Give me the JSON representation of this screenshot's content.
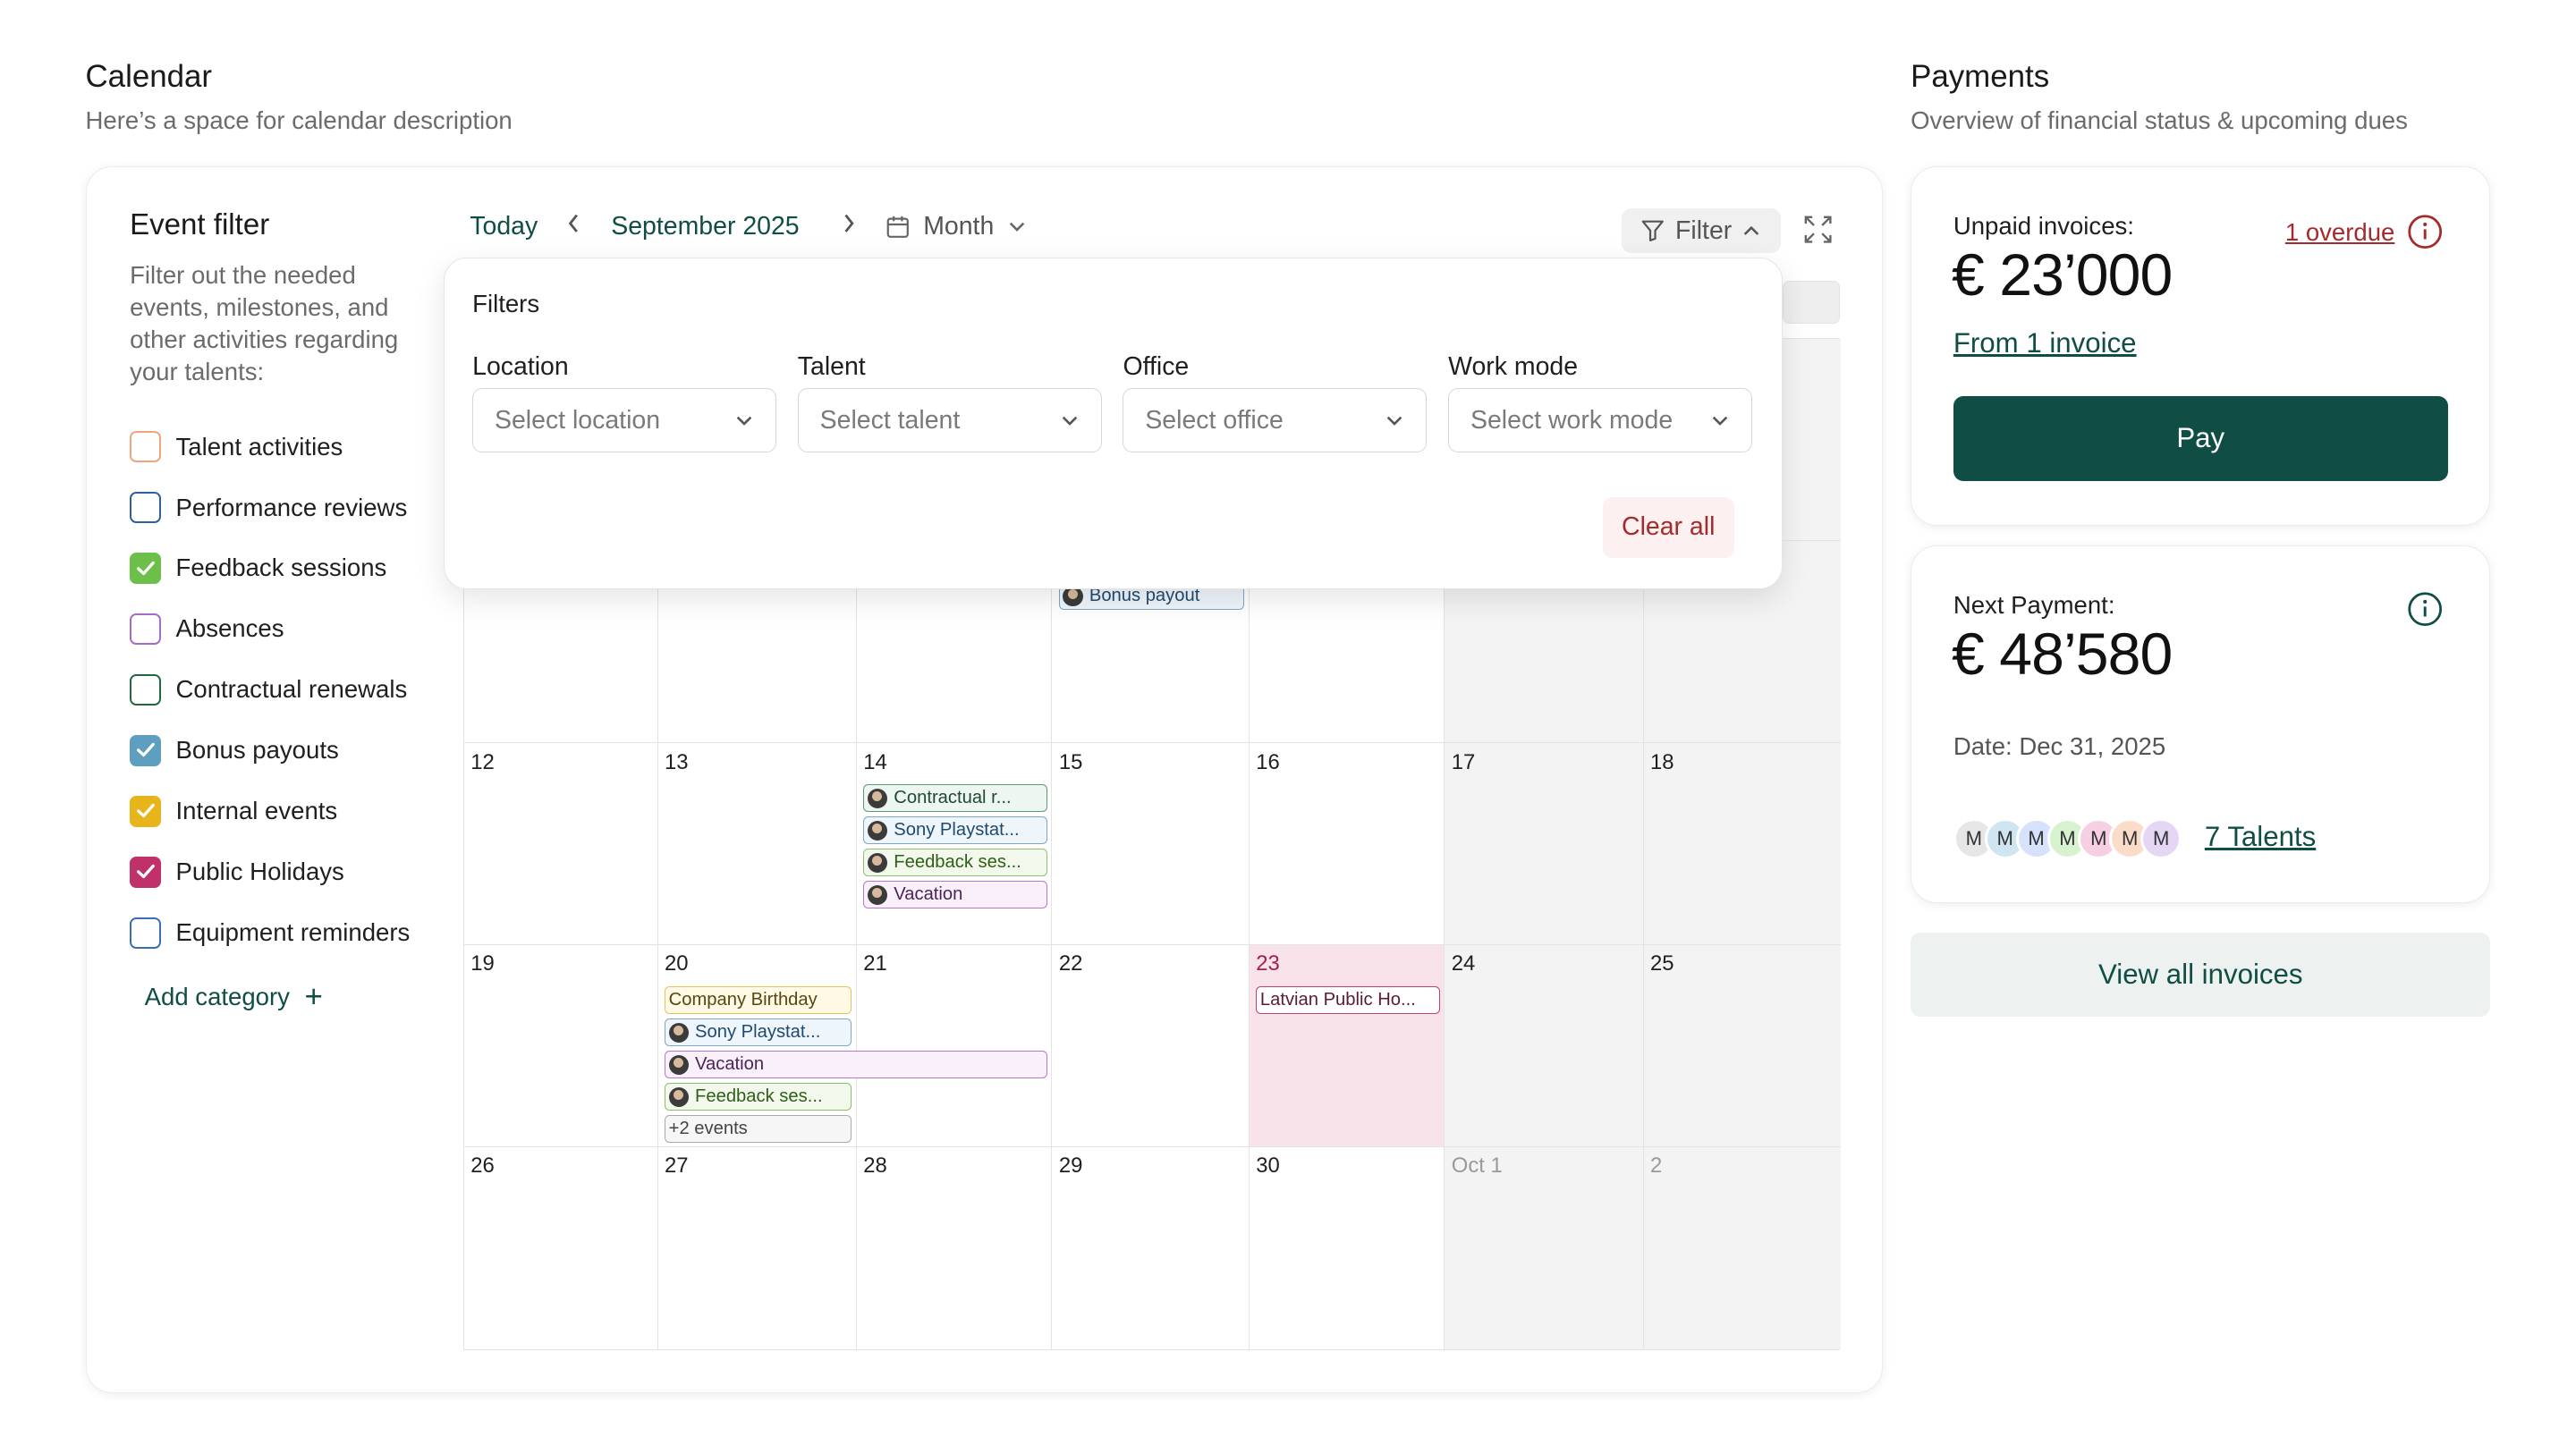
{
  "calendar": {
    "title": "Calendar",
    "description": "Here’s a space for calendar description"
  },
  "event_filter": {
    "title": "Event filter",
    "description": "Filter out the needed events, milestones, and other activities regarding your talents:",
    "categories": [
      {
        "label": "Talent activities",
        "checked": false,
        "color": "#f0a57a"
      },
      {
        "label": "Performance reviews",
        "checked": false,
        "color": "#2f5f9e"
      },
      {
        "label": "Feedback sessions",
        "checked": true,
        "color": "#6cc04a"
      },
      {
        "label": "Absences",
        "checked": false,
        "color": "#a66bc9"
      },
      {
        "label": "Contractual renewals",
        "checked": false,
        "color": "#1f6a45"
      },
      {
        "label": "Bonus payouts",
        "checked": true,
        "color": "#5e9fbf"
      },
      {
        "label": "Internal events",
        "checked": true,
        "color": "#e8b41c"
      },
      {
        "label": "Public Holidays",
        "checked": true,
        "color": "#c0306a"
      },
      {
        "label": "Equipment reminders",
        "checked": false,
        "color": "#3a6fb5"
      }
    ],
    "add_category": "Add category",
    "add_icon": "+"
  },
  "toolbar": {
    "today": "Today",
    "prev": "‹",
    "month_label": "September 2025",
    "next": "›",
    "view": "Month",
    "filter": "Filter"
  },
  "grid_rows": [
    {
      "days": [
        {
          "num": "",
          "weekend": false
        },
        {
          "num": "",
          "weekend": false
        },
        {
          "num": "",
          "weekend": false
        },
        {
          "num": "",
          "weekend": false
        },
        {
          "num": "",
          "weekend": false
        },
        {
          "num": "",
          "weekend": true
        },
        {
          "num": "",
          "weekend": true
        }
      ]
    },
    {
      "days": [
        {
          "num": "",
          "weekend": false
        },
        {
          "num": "",
          "weekend": false
        },
        {
          "num": "",
          "weekend": false
        },
        {
          "num": "",
          "weekend": false
        },
        {
          "num": "",
          "weekend": false
        },
        {
          "num": "",
          "weekend": true
        },
        {
          "num": "",
          "weekend": true
        }
      ]
    },
    {
      "days": [
        {
          "num": "12",
          "weekend": false
        },
        {
          "num": "13",
          "weekend": false
        },
        {
          "num": "14",
          "weekend": false
        },
        {
          "num": "15",
          "weekend": false
        },
        {
          "num": "16",
          "weekend": false
        },
        {
          "num": "17",
          "weekend": true
        },
        {
          "num": "18",
          "weekend": true
        }
      ]
    },
    {
      "days": [
        {
          "num": "19",
          "weekend": false
        },
        {
          "num": "20",
          "weekend": false
        },
        {
          "num": "21",
          "weekend": false
        },
        {
          "num": "22",
          "weekend": false
        },
        {
          "num": "23",
          "weekend": false,
          "today": true
        },
        {
          "num": "24",
          "weekend": true
        },
        {
          "num": "25",
          "weekend": true
        }
      ]
    },
    {
      "days": [
        {
          "num": "26",
          "weekend": false
        },
        {
          "num": "27",
          "weekend": false
        },
        {
          "num": "28",
          "weekend": false
        },
        {
          "num": "29",
          "weekend": false
        },
        {
          "num": "30",
          "weekend": false
        },
        {
          "num": "Oct 1",
          "weekend": true,
          "muted": true
        },
        {
          "num": "2",
          "weekend": true,
          "muted": true
        }
      ]
    }
  ],
  "events": [
    {
      "row": 1,
      "col": 3,
      "slot": 0,
      "span": 1,
      "label": "Bonus payout",
      "style": "blue",
      "avatar": true
    },
    {
      "row": 2,
      "col": 2,
      "slot": 0,
      "span": 1,
      "label": "Contractual r...",
      "style": "contract",
      "avatar": true
    },
    {
      "row": 2,
      "col": 2,
      "slot": 1,
      "span": 1,
      "label": "Sony Playstat...",
      "style": "blue",
      "avatar": true
    },
    {
      "row": 2,
      "col": 2,
      "slot": 2,
      "span": 1,
      "label": "Feedback ses...",
      "style": "green",
      "avatar": true
    },
    {
      "row": 2,
      "col": 2,
      "slot": 3,
      "span": 1,
      "label": "Vacation",
      "style": "purple",
      "avatar": true
    },
    {
      "row": 3,
      "col": 1,
      "slot": 0,
      "span": 1,
      "label": "Company Birthday",
      "style": "yellow",
      "avatar": false
    },
    {
      "row": 3,
      "col": 1,
      "slot": 1,
      "span": 1,
      "label": "Sony Playstat...",
      "style": "blue",
      "avatar": true
    },
    {
      "row": 3,
      "col": 1,
      "slot": 2,
      "span": 2,
      "label": "Vacation",
      "style": "purple",
      "avatar": true
    },
    {
      "row": 3,
      "col": 1,
      "slot": 3,
      "span": 1,
      "label": "Feedback ses...",
      "style": "green",
      "avatar": true
    },
    {
      "row": 3,
      "col": 1,
      "slot": 4,
      "span": 1,
      "label": "+2 events",
      "style": "grey",
      "avatar": false
    },
    {
      "row": 3,
      "col": 4,
      "slot": 0,
      "span": 1,
      "label": "Latvian Public Ho...",
      "style": "pink",
      "avatar": false
    }
  ],
  "filters_popover": {
    "title": "Filters",
    "fields": [
      {
        "label": "Location",
        "placeholder": "Select location"
      },
      {
        "label": "Talent",
        "placeholder": "Select talent"
      },
      {
        "label": "Office",
        "placeholder": "Select office"
      },
      {
        "label": "Work mode",
        "placeholder": "Select work mode"
      }
    ],
    "clear_all": "Clear all"
  },
  "payments": {
    "title": "Payments",
    "description": "Overview of financial status & upcoming dues",
    "unpaid": {
      "label": "Unpaid invoices:",
      "amount": "€ 23’000",
      "overdue_link": "1 overdue",
      "from_link": "From 1 invoice",
      "pay_button": "Pay"
    },
    "next": {
      "label": "Next Payment:",
      "amount": "€ 48’580",
      "date": "Date: Dec 31, 2025",
      "avatars": [
        {
          "initial": "M",
          "color": "#e6e6e6"
        },
        {
          "initial": "M",
          "color": "#cfe6f2"
        },
        {
          "initial": "M",
          "color": "#d6e2fb"
        },
        {
          "initial": "M",
          "color": "#d6f2cf"
        },
        {
          "initial": "M",
          "color": "#f6cfe2"
        },
        {
          "initial": "M",
          "color": "#fbdcc9"
        },
        {
          "initial": "M",
          "color": "#e6d6f6"
        }
      ],
      "talents_link": "7 Talents"
    },
    "view_all": "View all invoices"
  },
  "colors": {
    "brand": "#0f4d45",
    "danger": "#a52a2a",
    "today_bg": "#f9e3ea"
  }
}
